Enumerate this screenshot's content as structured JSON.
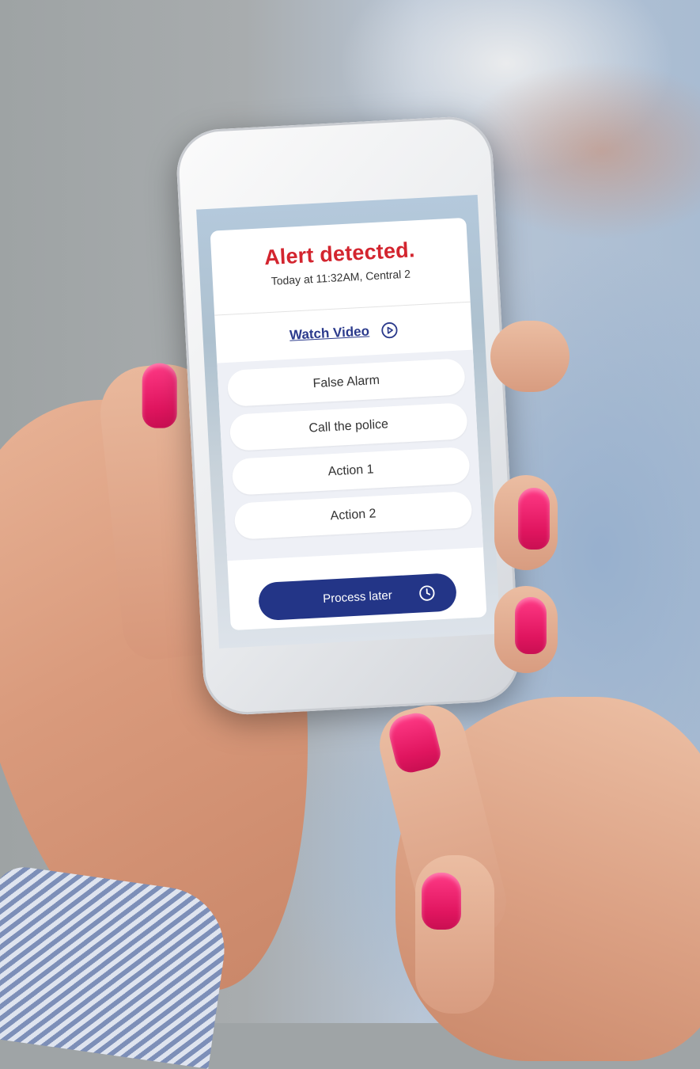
{
  "alert": {
    "title": "Alert detected.",
    "subtitle": "Today at 11:32AM, Central 2",
    "watch_label": "Watch Video"
  },
  "actions": [
    {
      "label": "False Alarm"
    },
    {
      "label": "Call the police"
    },
    {
      "label": "Action 1"
    },
    {
      "label": "Action 2"
    }
  ],
  "footer": {
    "later_label": "Process later"
  },
  "icons": {
    "watch": "play-circle-icon",
    "later": "clock-icon"
  },
  "colors": {
    "alert_red": "#d3252f",
    "link_blue": "#2b3a8c",
    "button_navy": "#233587",
    "nail_pink": "#e0155f"
  }
}
